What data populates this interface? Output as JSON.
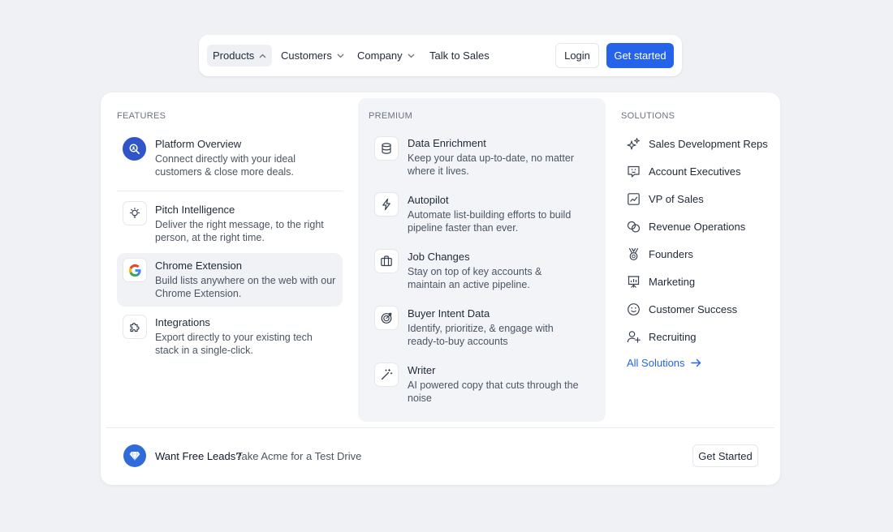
{
  "nav": {
    "items": [
      {
        "label": "Products"
      },
      {
        "label": "Customers"
      },
      {
        "label": "Company"
      },
      {
        "label": "Talk to Sales"
      }
    ],
    "login_label": "Login",
    "get_started_label": "Get started",
    "accent_color": "#2563eb"
  },
  "features": {
    "heading": "FEATURES",
    "items": [
      {
        "title": "Platform Overview",
        "desc": "Connect directly with your ideal customers & close more deals.",
        "icon": "search-icon"
      },
      {
        "title": "Pitch Intelligence",
        "desc": "Deliver the right message, to the right person, at the right time.",
        "icon": "lightbulb-icon"
      },
      {
        "title": "Chrome Extension",
        "desc": "Build lists anywhere on the web with our Chrome Extension.",
        "icon": "google-icon"
      },
      {
        "title": "Integrations",
        "desc": "Export directly to your existing tech stack in a single-click.",
        "icon": "puzzle-icon"
      }
    ]
  },
  "premium": {
    "heading": "PREMIUM",
    "items": [
      {
        "title": "Data Enrichment",
        "desc": "Keep your data up-to-date, no matter where it lives.",
        "icon": "database-icon"
      },
      {
        "title": "Autopilot",
        "desc": "Automate list-building efforts to build pipeline faster than ever.",
        "icon": "lightning-icon"
      },
      {
        "title": "Job Changes",
        "desc": "Stay on top of key accounts & maintain an active pipeline.",
        "icon": "briefcase-icon"
      },
      {
        "title": "Buyer Intent Data",
        "desc": "Identify, prioritize, & engage with ready-to-buy accounts",
        "icon": "target-icon"
      },
      {
        "title": "Writer",
        "desc": "AI powered copy that cuts through the noise",
        "icon": "magic-wand-icon"
      }
    ]
  },
  "solutions": {
    "heading": "SOLUTIONS",
    "items": [
      {
        "label": "Sales Development Reps",
        "icon": "sparkles-icon"
      },
      {
        "label": "Account Executives",
        "icon": "chat-icon"
      },
      {
        "label": "VP of Sales",
        "icon": "chart-icon"
      },
      {
        "label": "Revenue Operations",
        "icon": "coins-icon"
      },
      {
        "label": "Founders",
        "icon": "medal-icon"
      },
      {
        "label": "Marketing",
        "icon": "presentation-icon"
      },
      {
        "label": "Customer Success",
        "icon": "smile-icon"
      },
      {
        "label": "Recruiting",
        "icon": "user-add-icon"
      }
    ],
    "all_label": "All Solutions"
  },
  "footer": {
    "cta_strong": "Want Free Leads?",
    "cta_rest": "Take Acme for a Test Drive",
    "button_label": "Get Started",
    "icon": "diamond-icon"
  }
}
